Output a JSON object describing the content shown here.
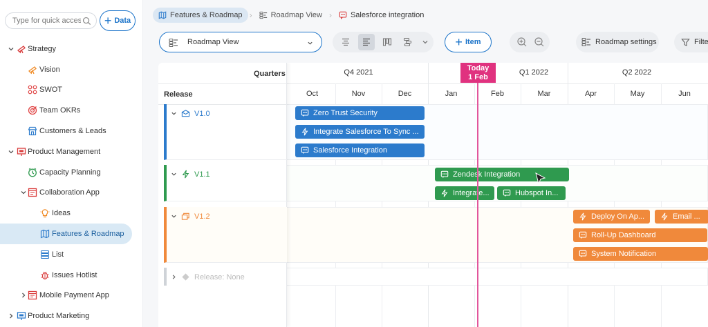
{
  "sidebar": {
    "search_placeholder": "Type for quick access",
    "data_button": "Data",
    "items": [
      {
        "label": "Strategy"
      },
      {
        "label": "Vision"
      },
      {
        "label": "SWOT"
      },
      {
        "label": "Team OKRs"
      },
      {
        "label": "Customers & Leads"
      },
      {
        "label": "Product Management"
      },
      {
        "label": "Capacity Planning"
      },
      {
        "label": "Collaboration App"
      },
      {
        "label": "Ideas"
      },
      {
        "label": "Features & Roadmap"
      },
      {
        "label": "List"
      },
      {
        "label": "Issues Hotlist"
      },
      {
        "label": "Mobile Payment App"
      },
      {
        "label": "Product Marketing"
      }
    ]
  },
  "breadcrumb": [
    "Features & Roadmap",
    "Roadmap View",
    "Salesforce integration"
  ],
  "toolbar": {
    "view_select": "Roadmap View",
    "item_button": "Item",
    "roadmap_settings": "Roadmap settings",
    "filter": "Filter"
  },
  "timeline": {
    "quarters_header": "Quarters",
    "release_header": "Release",
    "quarters": [
      "Q4 2021",
      "Q1 2022",
      "Q2 2022"
    ],
    "months": [
      "Oct",
      "Nov",
      "Dec",
      "Jan",
      "Feb",
      "Mar",
      "Apr",
      "May",
      "Jun"
    ],
    "today_label": "Today",
    "today_date": "1 Feb"
  },
  "releases": [
    {
      "name": "V1.0",
      "color": "#2c7bcc"
    },
    {
      "name": "V1.1",
      "color": "#2f9a4f"
    },
    {
      "name": "V1.2",
      "color": "#f0893b"
    },
    {
      "name": "Release: None",
      "color": "#bbbbbb"
    }
  ],
  "items": [
    {
      "label": "Zero Trust Security",
      "icon": "chat-icon"
    },
    {
      "label": "Integrate Salesforce To Sync ...",
      "icon": "bolt-icon"
    },
    {
      "label": "Salesforce Integration",
      "icon": "chat-icon"
    },
    {
      "label": "Zendesk Integration",
      "icon": "chat-icon"
    },
    {
      "label": "Integrate...",
      "icon": "bolt-icon"
    },
    {
      "label": "Hubspot In...",
      "icon": "chat-icon"
    },
    {
      "label": "Deploy On Ap...",
      "icon": "bolt-icon"
    },
    {
      "label": "Email ...",
      "icon": "bolt-icon"
    },
    {
      "label": "Roll-Up Dashboard",
      "icon": "chat-icon"
    },
    {
      "label": "System Notification",
      "icon": "chat-icon"
    }
  ]
}
